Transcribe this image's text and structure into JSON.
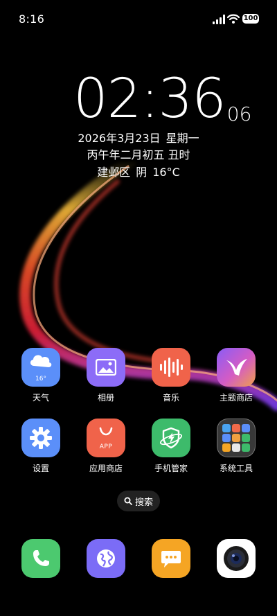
{
  "status_bar": {
    "time": "8:16",
    "battery": "100",
    "icons": [
      "signal-icon",
      "wifi-icon",
      "battery-icon"
    ]
  },
  "clock": {
    "hours_minutes": "02:36",
    "seconds": "06",
    "date": "2026年3月23日",
    "weekday": "星期一",
    "lunar": "丙午年二月初五 丑时",
    "location": "建邺区",
    "condition": "阴",
    "temperature": "16°C"
  },
  "apps": {
    "weather": {
      "label": "天气",
      "icon_text": "16°",
      "icon": "cloud-icon",
      "color": "#5b8ff9"
    },
    "gallery": {
      "label": "相册",
      "icon": "image-icon",
      "color": "#8c6cf7"
    },
    "music": {
      "label": "音乐",
      "icon": "sound-wave-icon",
      "color": "#f0634a"
    },
    "themes": {
      "label": "主题商店",
      "icon": "bird-icon",
      "color": "#c45cd6"
    },
    "settings": {
      "label": "设置",
      "icon": "gear-icon",
      "color": "#5b8ff9"
    },
    "app_store": {
      "label": "应用商店",
      "icon_text": "APP",
      "icon": "shopping-bag-icon",
      "color": "#f0634a"
    },
    "phone_manager": {
      "label": "手机管家",
      "icon": "shield-icon",
      "color": "#3dbb6b"
    },
    "system_tools": {
      "label": "系统工具",
      "icon": "folder-icon"
    }
  },
  "search": {
    "label": "搜索",
    "icon": "search-icon"
  },
  "dock": {
    "phone": {
      "icon": "phone-icon",
      "color": "#4cc96f"
    },
    "browser": {
      "icon": "globe-icon",
      "color": "#7b6cf6"
    },
    "messages": {
      "icon": "message-icon",
      "color": "#f5a524"
    },
    "camera": {
      "icon": "camera-icon",
      "color": "#ffffff"
    }
  }
}
